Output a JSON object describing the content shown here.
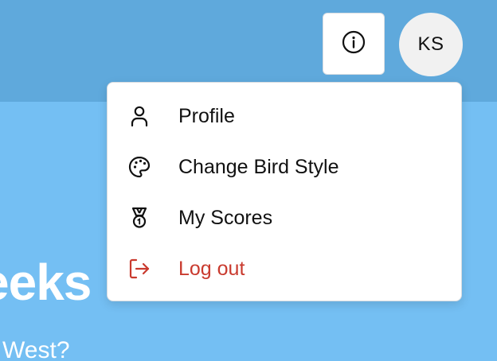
{
  "header": {
    "info_icon": "info-icon",
    "avatar_initials": "KS"
  },
  "hero": {
    "title_partial": "eeks",
    "subtitle_partial": "d West?"
  },
  "menu": {
    "items": [
      {
        "label": "Profile",
        "icon": "user-icon"
      },
      {
        "label": "Change Bird Style",
        "icon": "palette-icon"
      },
      {
        "label": "My Scores",
        "icon": "medal-icon"
      },
      {
        "label": "Log out",
        "icon": "logout-icon",
        "color": "#c93a2e"
      }
    ]
  },
  "colors": {
    "header_bg": "#5fa9dc",
    "page_bg": "#74bff3",
    "danger": "#c93a2e"
  }
}
